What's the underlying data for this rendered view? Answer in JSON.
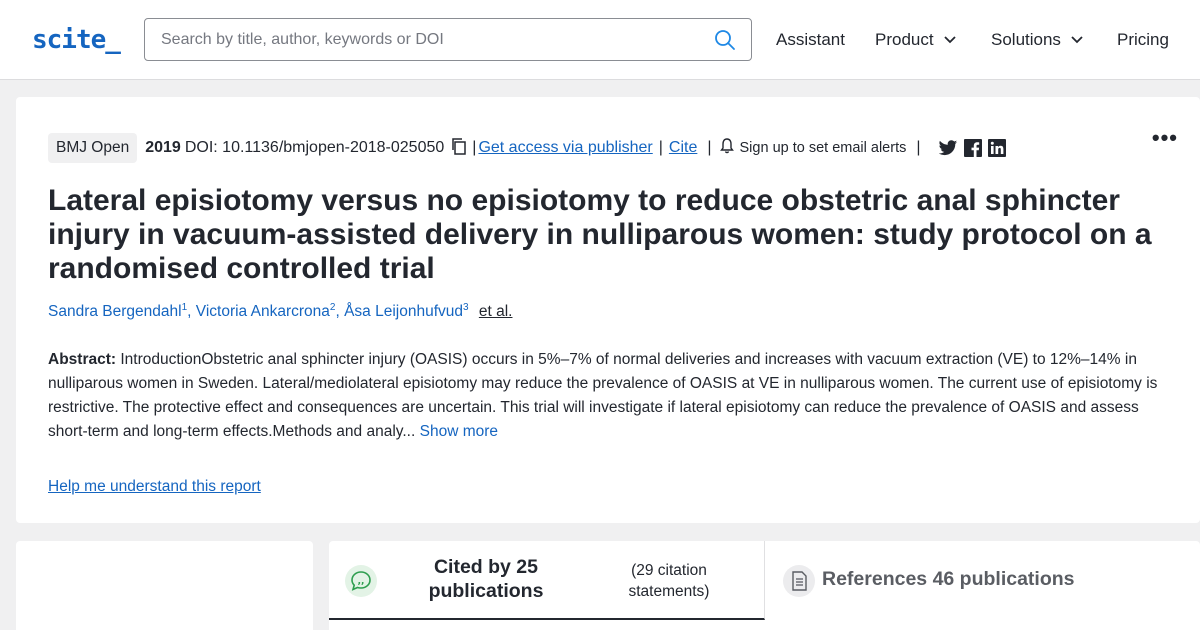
{
  "header": {
    "logo": "scite_",
    "search_placeholder": "Search by title, author, keywords or DOI",
    "nav": [
      {
        "label": "Assistant"
      },
      {
        "label": "Product"
      },
      {
        "label": "Solutions"
      },
      {
        "label": "Pricing"
      }
    ]
  },
  "paper": {
    "journal": "BMJ Open",
    "year": "2019",
    "doi": "DOI: 10.1136/bmjopen-2018-025050",
    "access_link": "Get access via publisher",
    "cite_link": "Cite",
    "alert_text": "Sign up to set email alerts",
    "separator": "|",
    "more": "•••",
    "title": "Lateral episiotomy versus no episiotomy to reduce obstetric anal sphincter injury in vacuum-assisted delivery in nulliparous women: study protocol on a randomised controlled trial",
    "authors": [
      {
        "name": "Sandra Bergendahl",
        "sup": "1"
      },
      {
        "name": "Victoria Ankarcrona",
        "sup": "2"
      },
      {
        "name": "Åsa Leijonhufvud",
        "sup": "3"
      }
    ],
    "author_sep": ",",
    "et_al": "et al.",
    "abstract_label": "Abstract:",
    "abstract_text": "IntroductionObstetric anal sphincter injury (OASIS) occurs in 5%–7% of normal deliveries and increases with vacuum extraction (VE) to 12%–14% in nulliparous women in Sweden. Lateral/mediolateral episiotomy may reduce the prevalence of OASIS at VE in nulliparous women. The current use of episiotomy is restrictive. The protective effect and consequences are uncertain. This trial will investigate if lateral episiotomy can reduce the prevalence of OASIS and assess short-term and long-term effects.Methods and analy...",
    "show_more": "Show more",
    "help_link": "Help me understand this report"
  },
  "tabs": {
    "cited_by": "Cited by 25 publications",
    "citation_statements": "(29 citation statements)",
    "references": "References 46 publications"
  },
  "colors": {
    "brand": "#1565c0",
    "background": "#f0f0f1",
    "text": "#23272f"
  },
  "icons": [
    "search-icon",
    "chevron-down-icon",
    "copy-icon",
    "bell-icon",
    "twitter-icon",
    "facebook-icon",
    "linkedin-icon",
    "quote-bubble-icon",
    "document-icon"
  ]
}
